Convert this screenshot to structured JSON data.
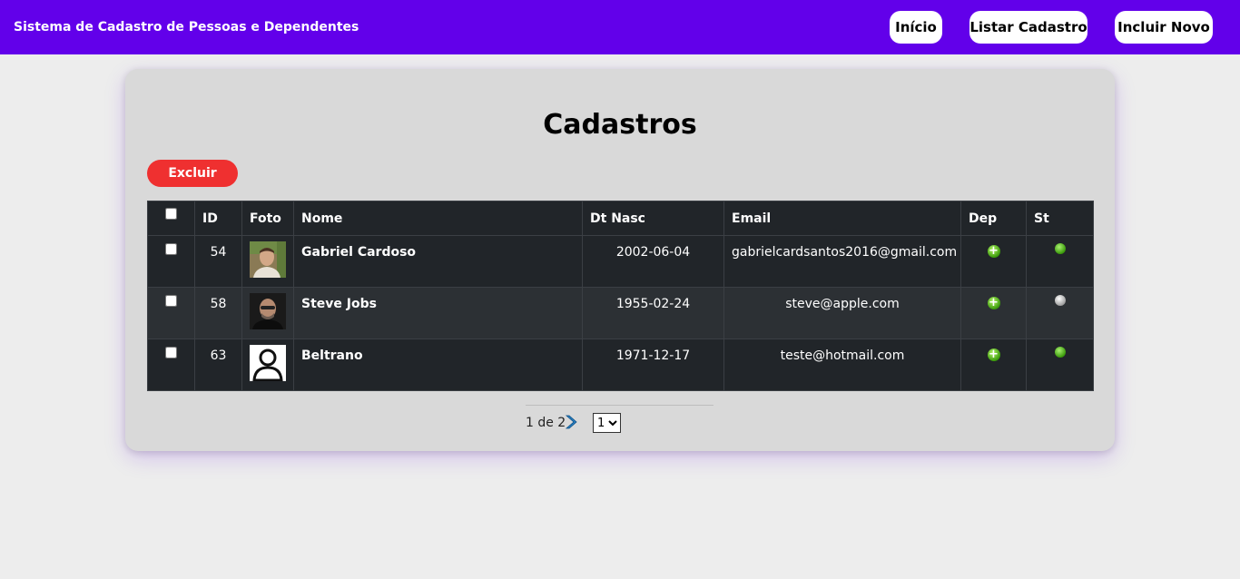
{
  "nav": {
    "brand": "Sistema de Cadastro de Pessoas e Dependentes",
    "links": [
      "Início",
      "Listar Cadastro",
      "Incluir Novo"
    ]
  },
  "page": {
    "title": "Cadastros",
    "delete_label": "Excluir"
  },
  "table": {
    "headers": [
      "ID",
      "Foto",
      "Nome",
      "Dt Nasc",
      "Email",
      "Dep",
      "St"
    ],
    "rows": [
      {
        "id": "54",
        "photo": "photo-gabriel",
        "name": "Gabriel Cardoso",
        "birth": "2002-06-04",
        "email": "gabrielcardsantos2016@gmail.com",
        "status": "active"
      },
      {
        "id": "58",
        "photo": "photo-steve",
        "name": "Steve Jobs",
        "birth": "1955-02-24",
        "email": "steve@apple.com",
        "status": "inactive"
      },
      {
        "id": "63",
        "photo": "photo-placeholder-avatar",
        "name": "Beltrano",
        "birth": "1971-12-17",
        "email": "teste@hotmail.com",
        "status": "active"
      }
    ]
  },
  "pagination": {
    "text": "1 de 2",
    "selected_page": "1",
    "options": [
      "1"
    ]
  },
  "colors": {
    "navbar": "#6200ea",
    "delete_button": "#ef3030",
    "table_bg": "#212529",
    "status_active": "#3a9a0a",
    "status_inactive": "#bdbdbd"
  },
  "icons": {
    "dependents": "plus-circle-icon",
    "next_page": "chevron-right-icon",
    "status": "status-dot-icon"
  }
}
